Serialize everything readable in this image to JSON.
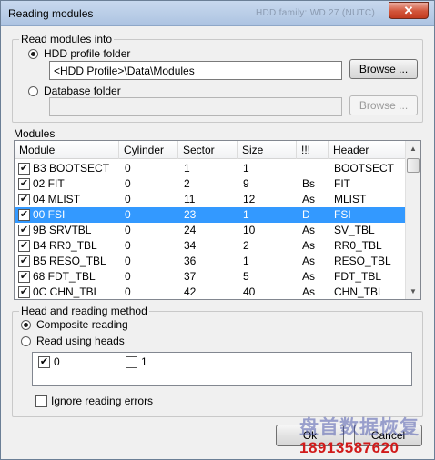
{
  "window": {
    "title": "Reading modules",
    "title_ghost": "HDD family: WD 27 (NUTC)",
    "close_glyph": "✕"
  },
  "read_into": {
    "group_title": "Read modules into",
    "hdd_profile_label": "HDD profile folder",
    "hdd_profile_selected": true,
    "hdd_profile_path": "<HDD Profile>\\Data\\Modules",
    "browse_label": "Browse ...",
    "database_label": "Database folder",
    "database_selected": false,
    "database_path": "",
    "browse_disabled_label": "Browse ..."
  },
  "modules": {
    "section_label": "Modules",
    "columns": [
      "Module",
      "Cylinder",
      "Sector",
      "Size",
      "!!!",
      "Header"
    ],
    "rows": [
      {
        "checked": true,
        "module": "B3 BOOTSECT",
        "cylinder": "0",
        "sector": "1",
        "size": "1",
        "flag": "",
        "header": "BOOTSECT",
        "selected": false
      },
      {
        "checked": true,
        "module": "02 FIT",
        "cylinder": "0",
        "sector": "2",
        "size": "9",
        "flag": "Bs",
        "header": "FIT",
        "selected": false
      },
      {
        "checked": true,
        "module": "04 MLIST",
        "cylinder": "0",
        "sector": "11",
        "size": "12",
        "flag": "As",
        "header": "MLIST",
        "selected": false
      },
      {
        "checked": true,
        "module": "00 FSI",
        "cylinder": "0",
        "sector": "23",
        "size": "1",
        "flag": "D",
        "header": "FSI",
        "selected": true
      },
      {
        "checked": true,
        "module": "9B SRVTBL",
        "cylinder": "0",
        "sector": "24",
        "size": "10",
        "flag": "As",
        "header": "SV_TBL",
        "selected": false
      },
      {
        "checked": true,
        "module": "B4 RR0_TBL",
        "cylinder": "0",
        "sector": "34",
        "size": "2",
        "flag": "As",
        "header": "RR0_TBL",
        "selected": false
      },
      {
        "checked": true,
        "module": "B5 RESO_TBL",
        "cylinder": "0",
        "sector": "36",
        "size": "1",
        "flag": "As",
        "header": "RESO_TBL",
        "selected": false
      },
      {
        "checked": true,
        "module": "68 FDT_TBL",
        "cylinder": "0",
        "sector": "37",
        "size": "5",
        "flag": "As",
        "header": "FDT_TBL",
        "selected": false
      },
      {
        "checked": true,
        "module": "0C CHN_TBL",
        "cylinder": "0",
        "sector": "42",
        "size": "40",
        "flag": "As",
        "header": "CHN_TBL",
        "selected": false
      }
    ]
  },
  "method": {
    "group_title": "Head and reading method",
    "composite_label": "Composite reading",
    "composite_selected": true,
    "heads_label": "Read using heads",
    "heads_selected": false,
    "heads": [
      {
        "label": "0",
        "checked": true
      },
      {
        "label": "1",
        "checked": false
      }
    ],
    "ignore_errors_label": "Ignore reading errors",
    "ignore_errors_checked": false
  },
  "footer": {
    "ok_label": "Ok",
    "cancel_label": "Cancel"
  },
  "watermark": {
    "line1": "盘首数据恢复",
    "line2": "18913587620"
  },
  "colors": {
    "selection": "#3399ff",
    "titlebar": "#b8cce6",
    "close": "#c23b20"
  }
}
